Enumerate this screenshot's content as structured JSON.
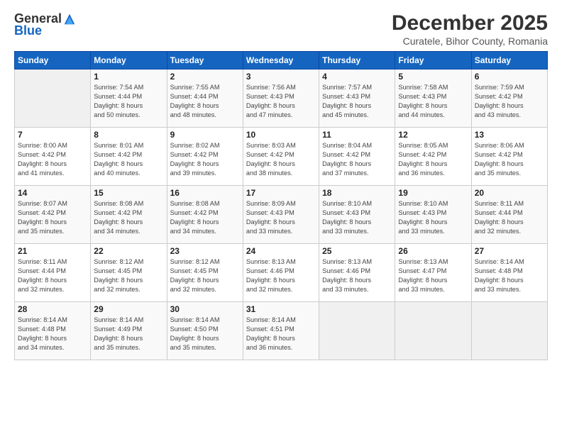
{
  "logo": {
    "general": "General",
    "blue": "Blue"
  },
  "title": "December 2025",
  "subtitle": "Curatele, Bihor County, Romania",
  "days_header": [
    "Sunday",
    "Monday",
    "Tuesday",
    "Wednesday",
    "Thursday",
    "Friday",
    "Saturday"
  ],
  "weeks": [
    [
      {
        "day": "",
        "info": ""
      },
      {
        "day": "1",
        "info": "Sunrise: 7:54 AM\nSunset: 4:44 PM\nDaylight: 8 hours\nand 50 minutes."
      },
      {
        "day": "2",
        "info": "Sunrise: 7:55 AM\nSunset: 4:44 PM\nDaylight: 8 hours\nand 48 minutes."
      },
      {
        "day": "3",
        "info": "Sunrise: 7:56 AM\nSunset: 4:43 PM\nDaylight: 8 hours\nand 47 minutes."
      },
      {
        "day": "4",
        "info": "Sunrise: 7:57 AM\nSunset: 4:43 PM\nDaylight: 8 hours\nand 45 minutes."
      },
      {
        "day": "5",
        "info": "Sunrise: 7:58 AM\nSunset: 4:43 PM\nDaylight: 8 hours\nand 44 minutes."
      },
      {
        "day": "6",
        "info": "Sunrise: 7:59 AM\nSunset: 4:42 PM\nDaylight: 8 hours\nand 43 minutes."
      }
    ],
    [
      {
        "day": "7",
        "info": "Sunrise: 8:00 AM\nSunset: 4:42 PM\nDaylight: 8 hours\nand 41 minutes."
      },
      {
        "day": "8",
        "info": "Sunrise: 8:01 AM\nSunset: 4:42 PM\nDaylight: 8 hours\nand 40 minutes."
      },
      {
        "day": "9",
        "info": "Sunrise: 8:02 AM\nSunset: 4:42 PM\nDaylight: 8 hours\nand 39 minutes."
      },
      {
        "day": "10",
        "info": "Sunrise: 8:03 AM\nSunset: 4:42 PM\nDaylight: 8 hours\nand 38 minutes."
      },
      {
        "day": "11",
        "info": "Sunrise: 8:04 AM\nSunset: 4:42 PM\nDaylight: 8 hours\nand 37 minutes."
      },
      {
        "day": "12",
        "info": "Sunrise: 8:05 AM\nSunset: 4:42 PM\nDaylight: 8 hours\nand 36 minutes."
      },
      {
        "day": "13",
        "info": "Sunrise: 8:06 AM\nSunset: 4:42 PM\nDaylight: 8 hours\nand 35 minutes."
      }
    ],
    [
      {
        "day": "14",
        "info": "Sunrise: 8:07 AM\nSunset: 4:42 PM\nDaylight: 8 hours\nand 35 minutes."
      },
      {
        "day": "15",
        "info": "Sunrise: 8:08 AM\nSunset: 4:42 PM\nDaylight: 8 hours\nand 34 minutes."
      },
      {
        "day": "16",
        "info": "Sunrise: 8:08 AM\nSunset: 4:42 PM\nDaylight: 8 hours\nand 34 minutes."
      },
      {
        "day": "17",
        "info": "Sunrise: 8:09 AM\nSunset: 4:43 PM\nDaylight: 8 hours\nand 33 minutes."
      },
      {
        "day": "18",
        "info": "Sunrise: 8:10 AM\nSunset: 4:43 PM\nDaylight: 8 hours\nand 33 minutes."
      },
      {
        "day": "19",
        "info": "Sunrise: 8:10 AM\nSunset: 4:43 PM\nDaylight: 8 hours\nand 33 minutes."
      },
      {
        "day": "20",
        "info": "Sunrise: 8:11 AM\nSunset: 4:44 PM\nDaylight: 8 hours\nand 32 minutes."
      }
    ],
    [
      {
        "day": "21",
        "info": "Sunrise: 8:11 AM\nSunset: 4:44 PM\nDaylight: 8 hours\nand 32 minutes."
      },
      {
        "day": "22",
        "info": "Sunrise: 8:12 AM\nSunset: 4:45 PM\nDaylight: 8 hours\nand 32 minutes."
      },
      {
        "day": "23",
        "info": "Sunrise: 8:12 AM\nSunset: 4:45 PM\nDaylight: 8 hours\nand 32 minutes."
      },
      {
        "day": "24",
        "info": "Sunrise: 8:13 AM\nSunset: 4:46 PM\nDaylight: 8 hours\nand 32 minutes."
      },
      {
        "day": "25",
        "info": "Sunrise: 8:13 AM\nSunset: 4:46 PM\nDaylight: 8 hours\nand 33 minutes."
      },
      {
        "day": "26",
        "info": "Sunrise: 8:13 AM\nSunset: 4:47 PM\nDaylight: 8 hours\nand 33 minutes."
      },
      {
        "day": "27",
        "info": "Sunrise: 8:14 AM\nSunset: 4:48 PM\nDaylight: 8 hours\nand 33 minutes."
      }
    ],
    [
      {
        "day": "28",
        "info": "Sunrise: 8:14 AM\nSunset: 4:48 PM\nDaylight: 8 hours\nand 34 minutes."
      },
      {
        "day": "29",
        "info": "Sunrise: 8:14 AM\nSunset: 4:49 PM\nDaylight: 8 hours\nand 35 minutes."
      },
      {
        "day": "30",
        "info": "Sunrise: 8:14 AM\nSunset: 4:50 PM\nDaylight: 8 hours\nand 35 minutes."
      },
      {
        "day": "31",
        "info": "Sunrise: 8:14 AM\nSunset: 4:51 PM\nDaylight: 8 hours\nand 36 minutes."
      },
      {
        "day": "",
        "info": ""
      },
      {
        "day": "",
        "info": ""
      },
      {
        "day": "",
        "info": ""
      }
    ]
  ]
}
